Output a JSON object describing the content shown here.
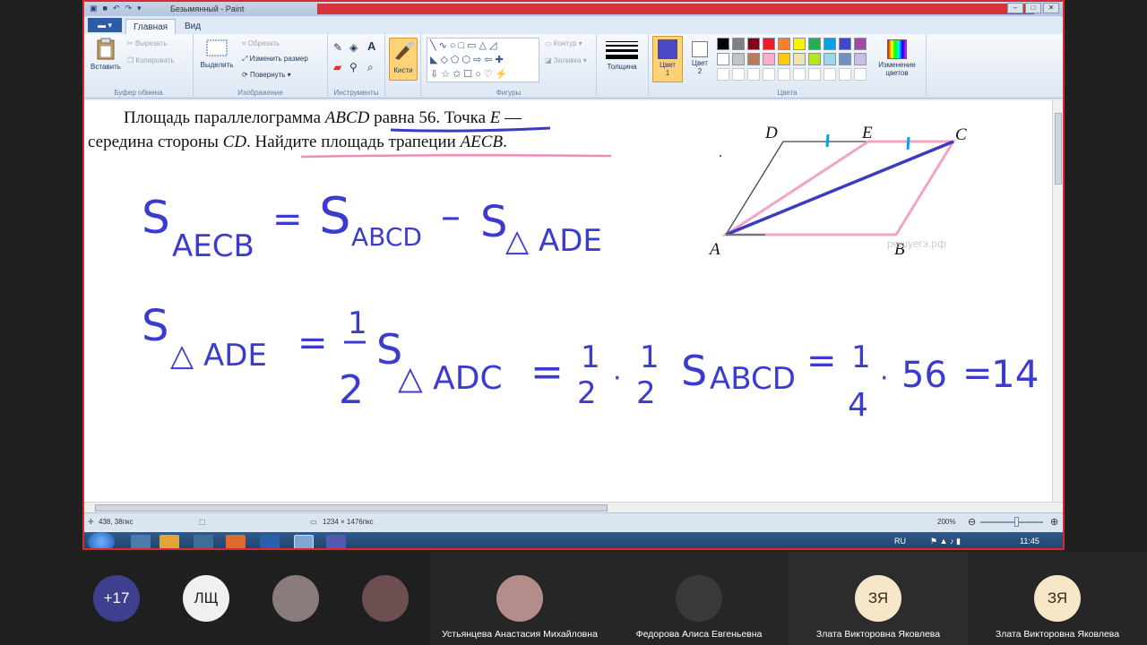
{
  "window": {
    "title": "Безымянный - Paint",
    "buttons": [
      "–",
      "□",
      "✕"
    ]
  },
  "tabs": {
    "file": "▬ ▾",
    "home": "Главная",
    "view": "Вид"
  },
  "ribbon": {
    "clipboard": {
      "label": "Буфер обмена",
      "paste": "Вставить",
      "cut": "Вырезать",
      "copy": "Копировать"
    },
    "image": {
      "label": "Изображение",
      "select": "Выделить",
      "crop": "Обрезать",
      "resize": "Изменить размер",
      "rotate": "Повернуть ▾"
    },
    "tools": {
      "label": "Инструменты"
    },
    "brushes": {
      "label": "Кисти"
    },
    "shapes": {
      "label": "Фигуры",
      "outline": "Контур ▾",
      "fill": "Заливка ▾"
    },
    "size": {
      "label": "Толщина"
    },
    "colors": {
      "label": "Цвета",
      "color1": "Цвет 1",
      "color2": "Цвет 2",
      "edit": "Изменение цветов",
      "color1_value": "#4b48c8",
      "color2_value": "#ffffff",
      "palette_row1": [
        "#000000",
        "#7f7f7f",
        "#880015",
        "#ed1c24",
        "#ff7f27",
        "#fff200",
        "#22b14c",
        "#00a2e8",
        "#3f48cc",
        "#a349a4"
      ],
      "palette_row2": [
        "#ffffff",
        "#c3c3c3",
        "#b97a57",
        "#ffaec9",
        "#ffc90e",
        "#efe4b0",
        "#b5e61d",
        "#99d9ea",
        "#7092be",
        "#c8bfe7"
      ]
    }
  },
  "canvas": {
    "problem_line1_a": "Площадь параллелограмма ",
    "problem_abcd": "ABCD",
    "problem_line1_b": " равна 56. Точка ",
    "problem_e": "E",
    "problem_line1_c": " —",
    "problem_line2_a": "середина стороны ",
    "problem_cd": "CD",
    "problem_line2_b": ". Найдите площадь трапеции ",
    "problem_aecb": "AECB",
    "problem_line2_c": ".",
    "figure_labels": {
      "D": "D",
      "E": "E",
      "C": "C",
      "A": "A",
      "B": "B"
    },
    "watermark": "решуегэ.рф",
    "formula1": {
      "left_s": "S",
      "left_sub": "AECB",
      "eq": "=",
      "s1": "S",
      "s1_sub": "ABCD",
      "minus": "–",
      "s2": "S",
      "s2_sub": "△ ADE"
    },
    "formula2": {
      "s": "S",
      "s_sub": "△ ADE",
      "eq": "=",
      "half_num": "1",
      "half_den": "2",
      "s2": "S",
      "s2_sub": "△ ADC",
      "eq2": "=",
      "f1_num": "1",
      "f1_den": "2",
      "dot1": "·",
      "f2_num": "1",
      "f2_den": "2",
      "s3": "S",
      "s3_sub": "ABCD",
      "eq3": "=",
      "f3_num": "1",
      "f3_den": "4",
      "dot2": "·",
      "value": "56",
      "eq4": "=",
      "result": "14"
    }
  },
  "status": {
    "coords": "438, 38пкс",
    "size": "1234 × 1476пкс",
    "zoom": "200%"
  },
  "taskbar": {
    "lang": "RU",
    "time": "11:45"
  },
  "participants": [
    {
      "initials": "+17",
      "name": "",
      "bg": "#3f3f8f",
      "fg": "#ffffff"
    },
    {
      "initials": "ЛЩ",
      "name": "",
      "bg": "#f0f0f0",
      "fg": "#222222"
    },
    {
      "initials": "",
      "name": "",
      "bg": "#8a7c7a",
      "fg": "#ffffff"
    },
    {
      "initials": "",
      "name": "",
      "bg": "#6d4f52",
      "fg": "#ffffff"
    },
    {
      "initials": "",
      "name": "Устьянцева Анастасия Михайловна",
      "bg": "#b48c8a",
      "fg": "#ffffff"
    },
    {
      "initials": "",
      "name": "Федорова Алиса Евгеньевна",
      "bg": "#3a3a3a",
      "fg": "#ffffff"
    },
    {
      "initials": "ЗЯ",
      "name": "Злата Викторовна Яковлева",
      "bg": "#f6e7c8",
      "fg": "#3b2a1a"
    },
    {
      "initials": "ЗЯ",
      "name": "Злата Викторовна Яковлева",
      "bg": "#f6e7c8",
      "fg": "#3b2a1a"
    }
  ]
}
